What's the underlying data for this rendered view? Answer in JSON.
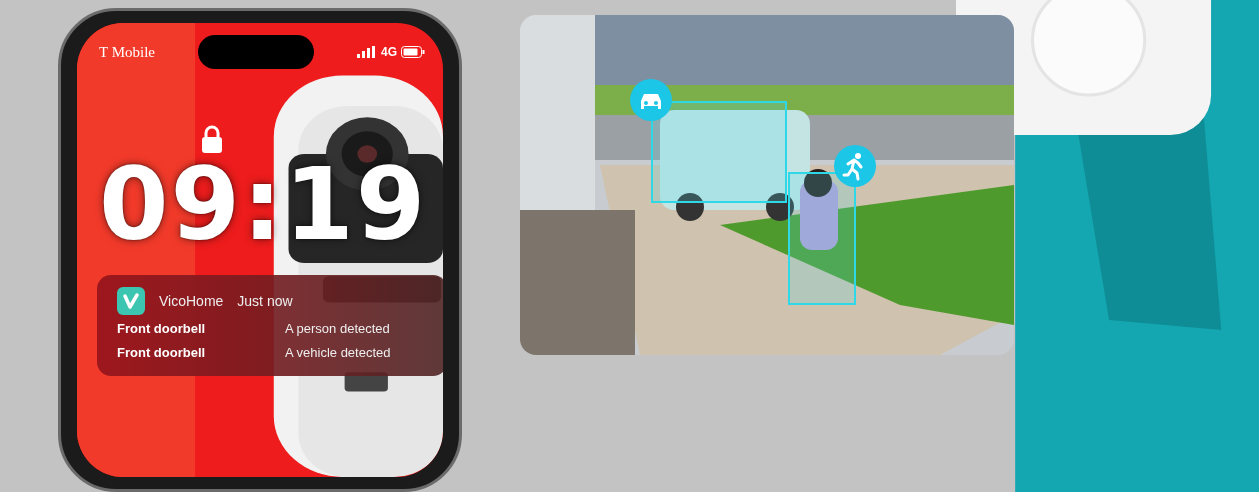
{
  "phone": {
    "status_bar": {
      "carrier": "T Mobile",
      "network": "4G"
    },
    "lock_screen": {
      "time": "09:19"
    },
    "notification": {
      "app": "VicoHome",
      "time": "Just now",
      "rows": [
        {
          "source": "Front doorbell",
          "message": "A person detected"
        },
        {
          "source": "Front doorbell",
          "message": "A vehicle detected"
        }
      ]
    }
  },
  "camera_view": {
    "detections": [
      {
        "kind": "vehicle"
      },
      {
        "kind": "person"
      }
    ]
  }
}
